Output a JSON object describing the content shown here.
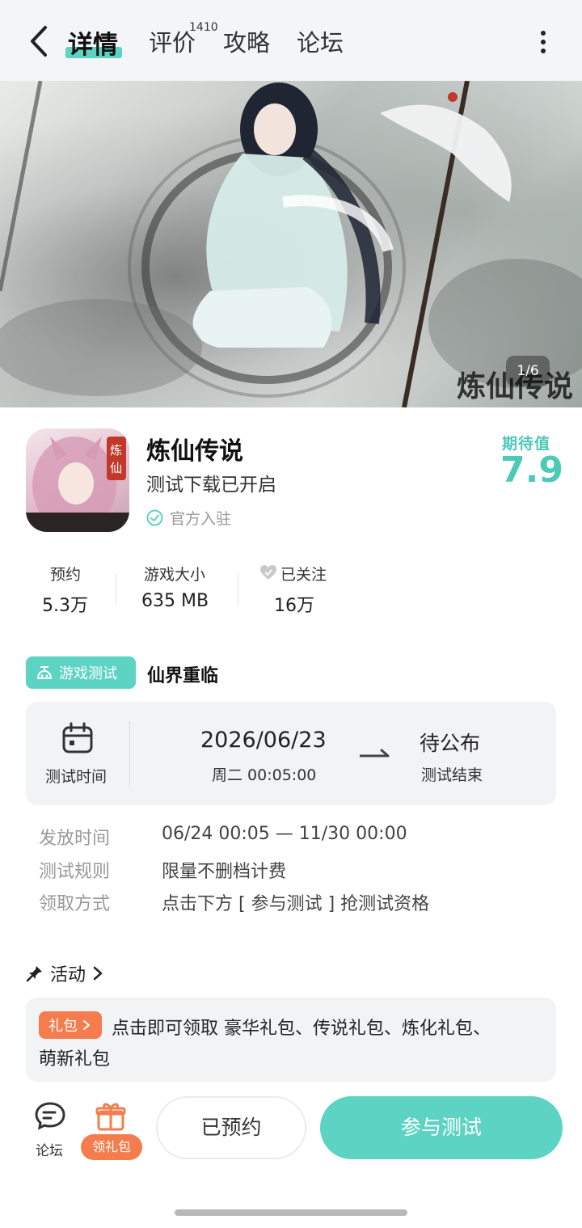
{
  "nav": {
    "tabs": [
      {
        "label": "详情"
      },
      {
        "label": "评价"
      },
      {
        "label": "攻略"
      },
      {
        "label": "论坛"
      }
    ],
    "review_count": "1410"
  },
  "banner": {
    "counter": "1/6"
  },
  "app": {
    "name": "炼仙传说",
    "subtitle": "测试下载已开启",
    "official": "官方入驻",
    "expect_label": "期待值",
    "expect_value": "7.9"
  },
  "stats": [
    {
      "label": "预约",
      "value": "5.3万"
    },
    {
      "label": "游戏大小",
      "value": "635 MB"
    },
    {
      "label": "已关注",
      "value": "16万"
    }
  ],
  "test": {
    "tag": "游戏测试",
    "title": "仙界重临",
    "time_label": "测试时间",
    "start_date": "2026/06/23",
    "start_detail": "周二  00:05:00",
    "end_value": "待公布",
    "end_label": "测试结束",
    "details": [
      {
        "key": "发放时间",
        "value": "06/24 00:05 — 11/30 00:00"
      },
      {
        "key": "测试规则",
        "value": "限量不删档计费"
      },
      {
        "key": "领取方式",
        "value": "点击下方 [ 参与测试 ] 抢测试资格"
      }
    ]
  },
  "activity": {
    "title": "活动",
    "gift_tag": "礼包",
    "text_line1": "点击即可领取 豪华礼包、传说礼包、炼化礼包、",
    "text_line2": "萌新礼包"
  },
  "bottom": {
    "forum_label": "论坛",
    "gift_label": "领礼包",
    "reserved_label": "已预约",
    "join_label": "参与测试"
  },
  "colors": {
    "accent": "#5dd3c3",
    "gift": "#f47c4d"
  }
}
